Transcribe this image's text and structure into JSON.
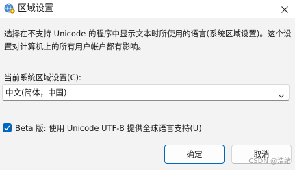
{
  "window": {
    "title": "区域设置",
    "close_icon": "close-icon",
    "title_icon": "globe-settings-icon"
  },
  "main": {
    "description": "选择在不支持 Unicode 的程序中显示文本时所使用的语言(系统区域设置)。这个设置对计算机上的所有用户帐户都有影响。",
    "locale_label": "当前系统区域设置(C):",
    "locale_value": "中文(简体，中国)",
    "beta_checked": true,
    "beta_label": "Beta 版: 使用 Unicode UTF-8 提供全球语言支持(U)"
  },
  "buttons": {
    "ok": "确定",
    "cancel": "取消"
  },
  "watermark": "CSDN @浩绪",
  "colors": {
    "accent": "#0067c0",
    "background": "#f3f3f3",
    "titlebar": "#ffffff"
  }
}
